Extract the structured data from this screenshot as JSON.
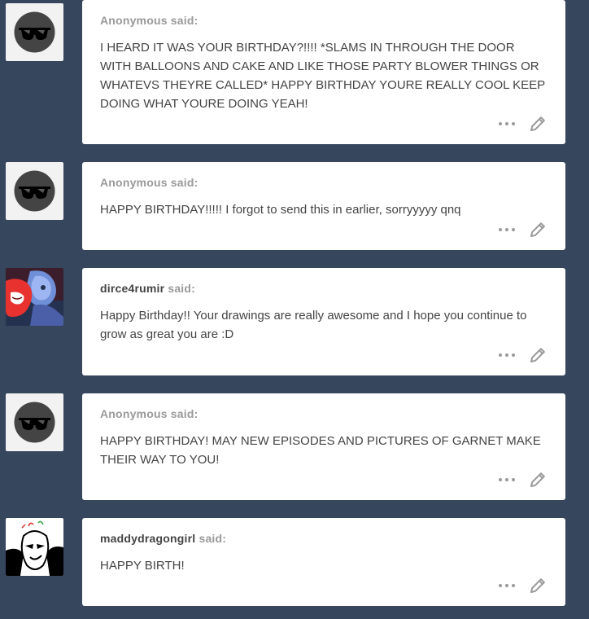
{
  "asks": [
    {
      "avatar": "anonymous-sunglasses-avatar",
      "username": "Anonymous",
      "said_label": "said:",
      "message": "I HEARD IT WAS YOUR BIRTHDAY?!!!! *SLAMS IN THROUGH THE DOOR WITH BALLOONS AND CAKE AND LIKE THOSE PARTY BLOWER THINGS OR WHATEVS THEYRE CALLED* HAPPY BIRTHDAY YOURE REALLY COOL KEEP DOING WHAT YOURE DOING YEAH!"
    },
    {
      "avatar": "anonymous-sunglasses-avatar",
      "username": "Anonymous",
      "said_label": "said:",
      "message": "HAPPY BIRTHDAY!!!!! I forgot to send this in earlier, sorryyyyy qnq"
    },
    {
      "avatar": "dirce4rumir-avatar",
      "username": "dirce4rumir",
      "said_label": "said:",
      "message": "Happy Birthday!! Your drawings are really awesome and I hope you continue to grow as great you are :D"
    },
    {
      "avatar": "anonymous-sunglasses-avatar",
      "username": "Anonymous",
      "said_label": "said:",
      "message": "HAPPY BIRTHDAY! MAY NEW EPISODES AND PICTURES OF GARNET MAKE THEIR WAY TO YOU!"
    },
    {
      "avatar": "maddydragongirl-avatar",
      "username": "maddydragongirl",
      "said_label": "said:",
      "message": "HAPPY BIRTH!"
    }
  ],
  "colors": {
    "background": "#36465d",
    "card": "#ffffff",
    "anonymous_name": "#999999",
    "user_name": "#444444",
    "text": "#444444",
    "controls": "#9a9a9a"
  },
  "icons": {
    "more": "ellipsis-icon",
    "edit": "pencil-icon"
  }
}
